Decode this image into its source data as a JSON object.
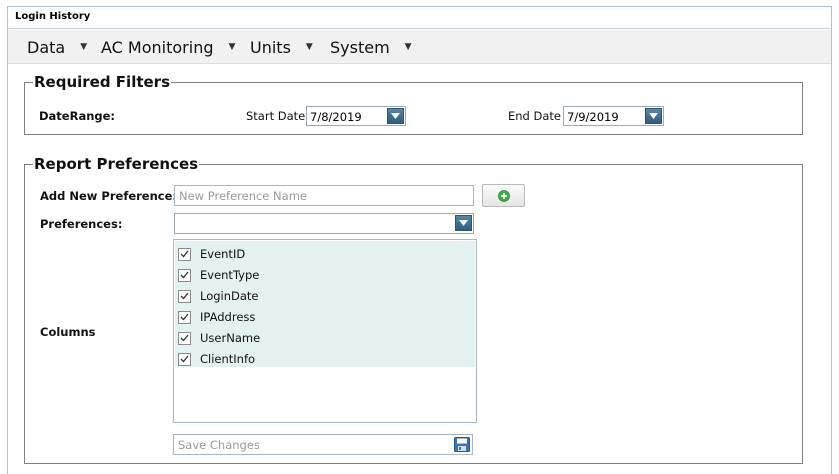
{
  "window": {
    "title": "Login History"
  },
  "menu": [
    {
      "label": "Data",
      "caret": "▼"
    },
    {
      "label": "AC Monitoring",
      "caret": "▼"
    },
    {
      "label": "Units",
      "caret": "▼"
    },
    {
      "label": "System",
      "caret": "▼"
    }
  ],
  "filters": {
    "legend": "Required Filters",
    "date_range_label": "DateRange:",
    "start_label": "Start Date",
    "start_value": "7/8/2019",
    "end_label": "End Date",
    "end_value": "7/9/2019"
  },
  "prefs": {
    "legend": "Report Preferences",
    "add_label": "Add New Preference:",
    "add_placeholder": "New Preference Name",
    "add_button_icon": "green-plus-icon",
    "prefs_label": "Preferences:",
    "prefs_value": "",
    "columns_label": "Columns",
    "columns": [
      {
        "label": "EventID",
        "checked": true
      },
      {
        "label": "EventType",
        "checked": true
      },
      {
        "label": "LoginDate",
        "checked": true
      },
      {
        "label": "IPAddress",
        "checked": true
      },
      {
        "label": "UserName",
        "checked": true
      },
      {
        "label": "ClientInfo",
        "checked": true
      }
    ],
    "save_placeholder": "Save Changes",
    "save_icon": "floppy-disk-icon"
  },
  "colors": {
    "dropdown_button": "#3f6c8c",
    "list_background": "#e3f1f1",
    "add_icon": "#3fa84a"
  }
}
